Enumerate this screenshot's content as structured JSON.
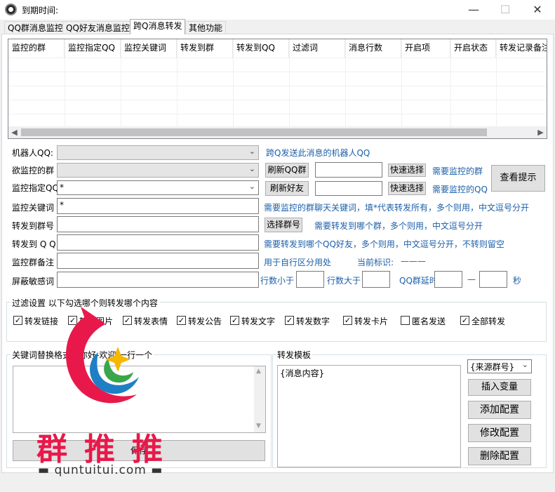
{
  "window": {
    "title": "到期时间:",
    "minimize": "—",
    "maximize": "☐",
    "close": "✕"
  },
  "tabs": [
    {
      "label": "QQ群消息监控"
    },
    {
      "label": "QQ好友消息监控"
    },
    {
      "label": "跨Q消息转发"
    },
    {
      "label": "其他功能"
    }
  ],
  "table": {
    "columns": [
      "监控的群",
      "监控指定QQ",
      "监控关键词",
      "转发到群",
      "转发到QQ",
      "过滤词",
      "消息行数",
      "开启项",
      "开启状态",
      "转发记录备注"
    ],
    "rows": []
  },
  "form": {
    "robot_qq": {
      "label": "机器人QQ:",
      "value": "",
      "hint": "跨Q发送此消息的机器人QQ"
    },
    "monitor_group": {
      "label": "欲监控的群",
      "value": "",
      "refresh_button": "刷新QQ群",
      "quick_input": "",
      "quick_button": "快速选择",
      "hint": "需要监控的群"
    },
    "monitor_qq": {
      "label": "监控指定QQ",
      "value": "*",
      "refresh_button": "刷新好友",
      "quick_input": "",
      "quick_button": "快速选择",
      "hint": "需要监控的QQ"
    },
    "view_tips_button": "查看提示",
    "keyword": {
      "label": "监控关键词",
      "value": "*",
      "hint": "需要监控的群聊天关键词，填*代表转发所有，多个则用，中文逗号分开"
    },
    "forward_group": {
      "label": "转发到群号",
      "value": "",
      "button": "选择群号",
      "hint": "需要转发到哪个群，多个则用，中文逗号分开"
    },
    "forward_qq": {
      "label": "转发到 Q Q",
      "value": "",
      "hint": "需要转发到哪个QQ好友，多个则用，中文逗号分开，不转则留空"
    },
    "group_note": {
      "label": "监控群备注",
      "value": "",
      "hint": "用于自行区分用处",
      "current_label": "当前标识:",
      "current_value": "———"
    },
    "block_words": {
      "label": "屏蔽敏感词",
      "value": "",
      "lines_lt_label": "行数小于",
      "lines_lt": "",
      "lines_gt_label": "行数大于",
      "lines_gt": "",
      "delay_label": "QQ群延时",
      "delay_from": "",
      "dash": "—",
      "delay_to": "",
      "sec": "秒"
    }
  },
  "filter": {
    "legend": "过滤设置 以下勾选哪个则转发哪个内容",
    "options": [
      {
        "label": "转发链接",
        "checked": true,
        "mark": "✓"
      },
      {
        "label": "转发图片",
        "checked": true,
        "mark": "✓"
      },
      {
        "label": "转发表情",
        "checked": true,
        "mark": "✓"
      },
      {
        "label": "转发公告",
        "checked": true,
        "mark": "✓"
      },
      {
        "label": "转发文字",
        "checked": true,
        "mark": "✓"
      },
      {
        "label": "转发数字",
        "checked": true,
        "mark": "✓"
      },
      {
        "label": "转发卡片",
        "checked": true,
        "mark": "✓"
      },
      {
        "label": "匿名发送",
        "checked": false,
        "mark": ""
      },
      {
        "label": "全部转发",
        "checked": true,
        "mark": "✓"
      }
    ]
  },
  "replace": {
    "legend": "关键词替换格式：你好-欢迎 一行一个",
    "text": "",
    "save_button": "保存"
  },
  "template": {
    "legend": "转发模板",
    "text": "{消息内容}",
    "variable_select": "{来源群号}",
    "insert_button": "插入变量",
    "add_button": "添加配置",
    "edit_button": "修改配置",
    "delete_button": "删除配置"
  },
  "watermark": {
    "text": "群推推",
    "url": "▬ quntuitui.com ▬"
  },
  "colors": {
    "hint": "#1c5fa8",
    "watermark_red": "#e8194a",
    "watermark_blue": "#1f7fc4",
    "watermark_green": "#3aa64a",
    "watermark_yellow": "#f5b800"
  }
}
